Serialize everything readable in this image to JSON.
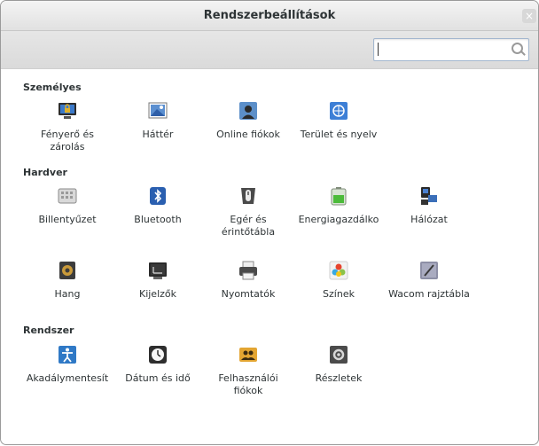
{
  "window": {
    "title": "Rendszerbeállítások",
    "close_glyph": "×"
  },
  "search": {
    "placeholder": "",
    "value": ""
  },
  "sections": {
    "personal": "Személyes",
    "hardware": "Hardver",
    "system": "Rendszer"
  },
  "personal": [
    {
      "label": "Fényerő és zárolás",
      "icon": "brightness-lock-icon"
    },
    {
      "label": "Háttér",
      "icon": "wallpaper-icon"
    },
    {
      "label": "Online fiókok",
      "icon": "online-accounts-icon"
    },
    {
      "label": "Terület és nyelv",
      "icon": "region-language-icon"
    }
  ],
  "hardware": [
    {
      "label": "Billentyűzet",
      "icon": "keyboard-icon"
    },
    {
      "label": "Bluetooth",
      "icon": "bluetooth-icon"
    },
    {
      "label": "Egér és érintőtábla",
      "icon": "mouse-touchpad-icon"
    },
    {
      "label": "Energiagazdálko",
      "icon": "power-battery-icon"
    },
    {
      "label": "Hálózat",
      "icon": "network-icon"
    },
    {
      "label": "Hang",
      "icon": "sound-speaker-icon"
    },
    {
      "label": "Kijelzők",
      "icon": "displays-icon"
    },
    {
      "label": "Nyomtatók",
      "icon": "printer-icon"
    },
    {
      "label": "Színek",
      "icon": "color-icon"
    },
    {
      "label": "Wacom rajztábla",
      "icon": "wacom-tablet-icon"
    }
  ],
  "system": [
    {
      "label": "Akadálymentesít",
      "icon": "accessibility-icon"
    },
    {
      "label": "Dátum és idő",
      "icon": "clock-icon"
    },
    {
      "label": "Felhasználói fiókok",
      "icon": "user-accounts-icon"
    },
    {
      "label": "Részletek",
      "icon": "details-icon"
    }
  ]
}
